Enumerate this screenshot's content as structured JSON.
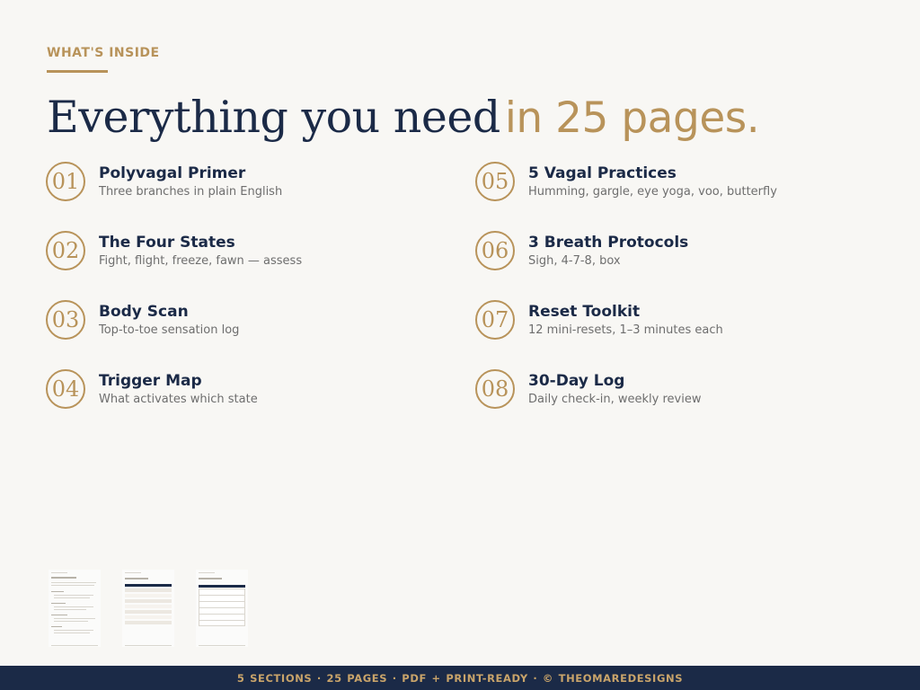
{
  "section": {
    "eyebrow": "WHAT'S INSIDE"
  },
  "headline": {
    "lead": "Everything you need",
    "accent": "in 25 pages."
  },
  "items": [
    {
      "number": "01",
      "title": "Polyvagal Primer",
      "description": "Three branches in plain English"
    },
    {
      "number": "02",
      "title": "The Four States",
      "description": "Fight, flight, freeze, fawn — assess"
    },
    {
      "number": "03",
      "title": "Body Scan",
      "description": "Top-to-toe sensation log"
    },
    {
      "number": "04",
      "title": "Trigger Map",
      "description": "What activates which state"
    },
    {
      "number": "05",
      "title": "5 Vagal Practices",
      "description": "Humming, gargle, eye yoga, voo, butterfly"
    },
    {
      "number": "06",
      "title": "3 Breath Protocols",
      "description": "Sigh, 4-7-8, box"
    },
    {
      "number": "07",
      "title": "Reset Toolkit",
      "description": "12 mini-resets, 1–3 minutes each"
    },
    {
      "number": "08",
      "title": "30-Day Log",
      "description": "Daily check-in, weekly review"
    }
  ],
  "footer": {
    "text": "5 SECTIONS  ·  25 PAGES  ·  PDF + PRINT-READY  ·  © THEOMAREDESIGNS"
  },
  "colors": {
    "navy": "#1b2a47",
    "gold": "#b8935a",
    "background": "#f8f7f4",
    "muted_text": "#6e6e6e"
  }
}
